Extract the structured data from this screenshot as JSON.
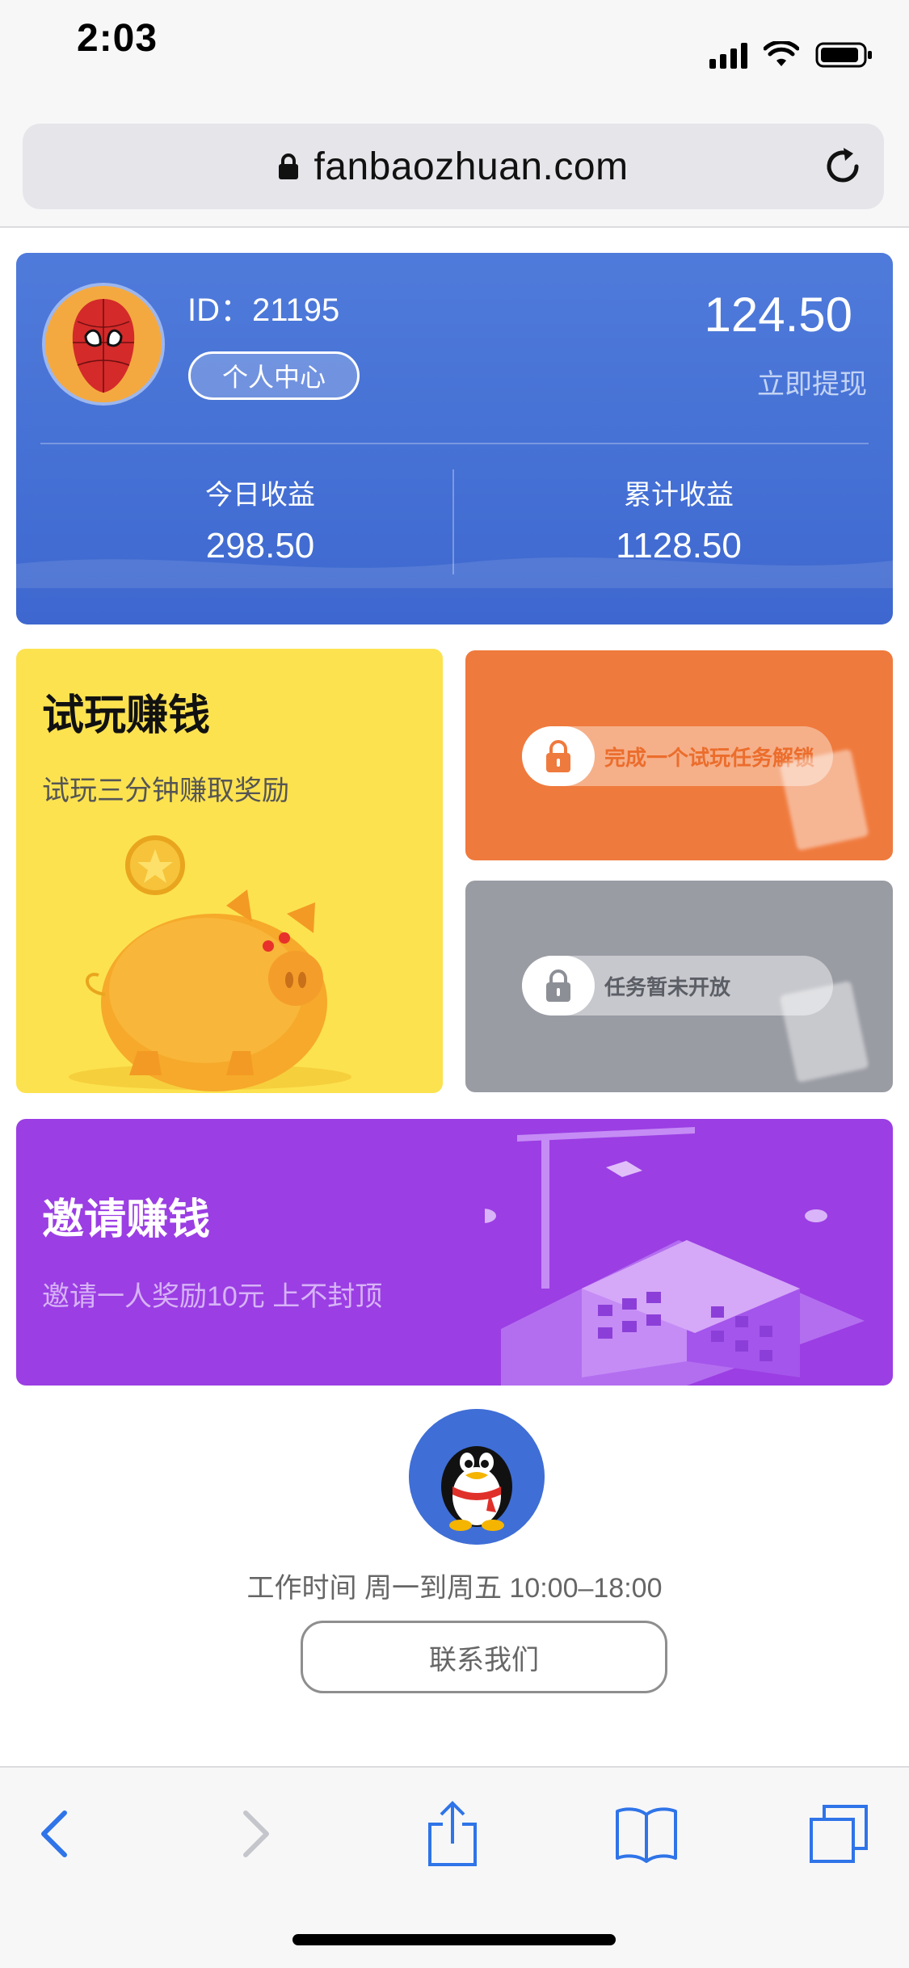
{
  "status_bar": {
    "time": "2:03"
  },
  "browser": {
    "url": "fanbaozhuan.com"
  },
  "profile": {
    "id_text": "ID：21195",
    "personal_center": "个人中心",
    "balance": "124.50",
    "withdraw": "立即提现",
    "today_label": "今日收益",
    "today_value": "298.50",
    "total_label": "累计收益",
    "total_value": "1128.50"
  },
  "tiles": {
    "trial": {
      "title": "试玩赚钱",
      "subtitle": "试玩三分钟赚取奖励"
    },
    "locked_task": {
      "text": "完成一个试玩任务解锁"
    },
    "closed_task": {
      "text": "任务暂未开放"
    },
    "invite": {
      "title": "邀请赚钱",
      "subtitle": "邀请一人奖励10元 上不封顶"
    }
  },
  "footer": {
    "work_hours": "工作时间 周一到周五 10:00–18:00",
    "contact_button": "联系我们"
  },
  "colors": {
    "card_blue": "#4a72d6",
    "tile_yellow": "#fce24f",
    "tile_orange": "#ef7a3d",
    "tile_gray": "#9a9ca4",
    "tile_purple": "#9b3ee3",
    "ios_blue": "#2f74e8"
  },
  "icons": [
    "lock-icon",
    "reload-icon",
    "back-icon",
    "forward-icon",
    "share-icon",
    "bookmarks-icon",
    "tabs-icon",
    "qq-penguin-icon",
    "spiderman-avatar",
    "piggy-bank-illustration",
    "building-illustration"
  ]
}
